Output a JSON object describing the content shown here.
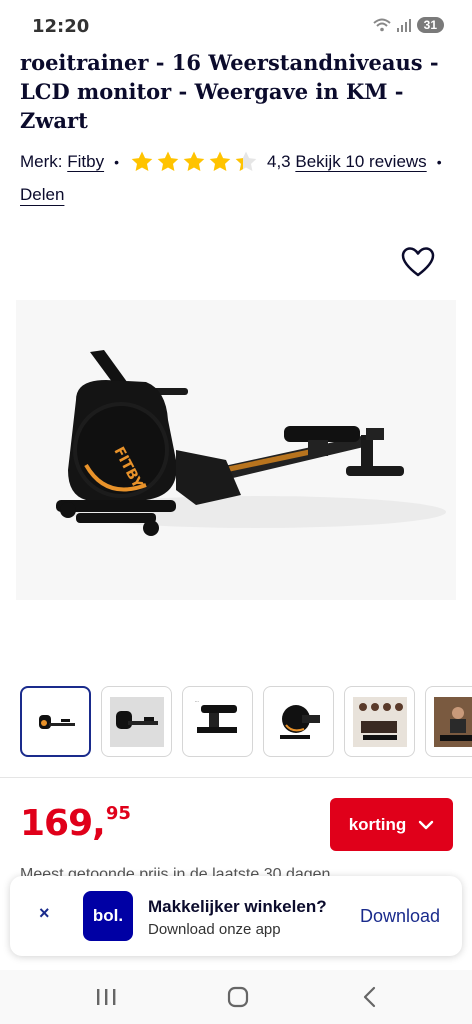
{
  "status_bar": {
    "time": "12:20",
    "battery": "31"
  },
  "product": {
    "title": "roeitrainer - 16 Weerstandniveaus - LCD monitor - Weergave in KM - Zwart",
    "brand_label": "Merk:",
    "brand": "Fitby",
    "rating": 4.3,
    "rating_text": "4,3",
    "reviews_link": "Bekijk 10 reviews",
    "share_link": "Delen",
    "image_brand_text": "FITBY"
  },
  "thumbnails": {
    "count": 6,
    "selected_index": 0
  },
  "price": {
    "integer": "169,",
    "decimals": "95"
  },
  "korting_button": {
    "label": "korting"
  },
  "partial_text": "Meest getoonde prijs in de laatste 30 dagen",
  "app_banner": {
    "logo_text": "bol.",
    "title": "Makkelijker winkelen?",
    "subtitle": "Download onze app",
    "download_label": "Download",
    "close_symbol": "×"
  },
  "colors": {
    "price_red": "#e0001a",
    "bol_blue": "#0000a4",
    "link_blue": "#1a2b8c",
    "star_yellow": "#ffc300"
  }
}
